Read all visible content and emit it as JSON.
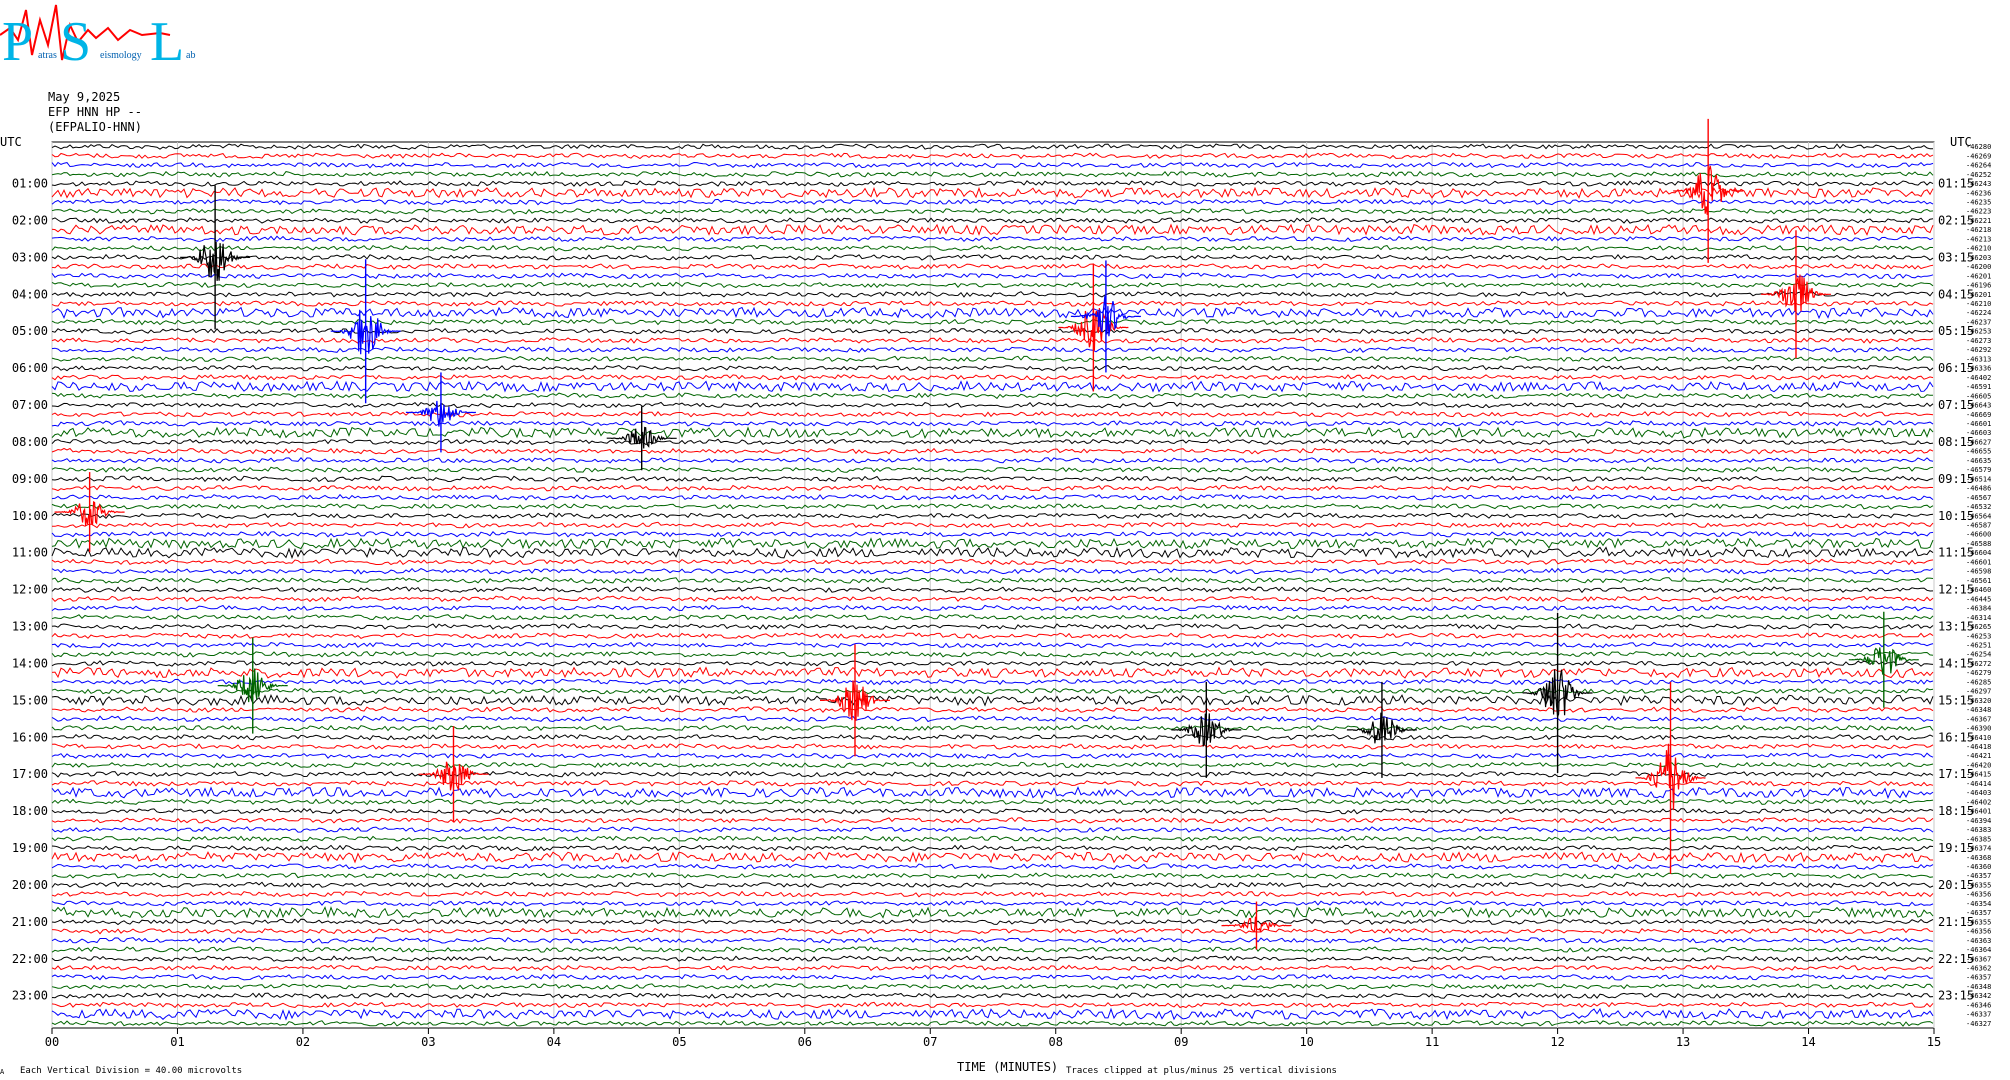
{
  "header": {
    "date": "May 9,2025",
    "station_line": "EFP HNN HP --",
    "channel_id": "(EFPALIO-HNN)"
  },
  "logo": {
    "letters": [
      "P",
      "S",
      "L"
    ],
    "words": [
      "atras",
      "eismology",
      "ab"
    ]
  },
  "chart_data": {
    "type": "line",
    "title": "",
    "xlabel": "TIME (MINUTES)",
    "x_ticks": [
      "00",
      "01",
      "02",
      "03",
      "04",
      "05",
      "06",
      "07",
      "08",
      "09",
      "10",
      "11",
      "12",
      "13",
      "14",
      "15"
    ],
    "xlim": [
      0,
      15
    ],
    "left_axis_title": "UTC",
    "right_axis_title": "UTC",
    "left_hour_labels": [
      "01:00",
      "02:00",
      "03:00",
      "04:00",
      "05:00",
      "06:00",
      "07:00",
      "08:00",
      "09:00",
      "10:00",
      "11:00",
      "12:00",
      "13:00",
      "14:00",
      "15:00",
      "16:00",
      "17:00",
      "18:00",
      "19:00",
      "20:00",
      "21:00",
      "22:00",
      "23:00"
    ],
    "right_hour_labels": [
      "01:15",
      "02:15",
      "03:15",
      "04:15",
      "05:15",
      "06:15",
      "07:15",
      "08:15",
      "09:15",
      "10:15",
      "11:15",
      "12:15",
      "13:15",
      "14:15",
      "15:15",
      "16:15",
      "17:15",
      "18:15",
      "19:15",
      "20:15",
      "21:15",
      "22:15",
      "23:15"
    ],
    "trace_count": 96,
    "trace_minutes": 15,
    "trace_colors": [
      "#000000",
      "#ff0000",
      "#0000ff",
      "#006400"
    ],
    "grid": true,
    "trace_offsets": [
      "-46280",
      "-46269",
      "-46264",
      "-46252",
      "-46243",
      "-46236",
      "-46235",
      "-46223",
      "-46221",
      "-46218",
      "-46213",
      "-46210",
      "-46203",
      "-46200",
      "-46201",
      "-46196",
      "-46201",
      "-46210",
      "-46224",
      "-46237",
      "-46253",
      "-46273",
      "-46292",
      "-46313",
      "-46336",
      "-46402",
      "-46591",
      "-46605",
      "-46643",
      "-46669",
      "-46601",
      "-46603",
      "-46627",
      "-46655",
      "-46635",
      "-46579",
      "-46514",
      "-46486",
      "-46567",
      "-46532",
      "-46564",
      "-46587",
      "-46600",
      "-46588",
      "-46604",
      "-46601",
      "-46598",
      "-46561",
      "-46460",
      "-46445",
      "-46384",
      "-46314",
      "-46265",
      "-46253",
      "-46251",
      "-46254",
      "-46272",
      "-46279",
      "-46285",
      "-46297",
      "-46320",
      "-46348",
      "-46367",
      "-46390",
      "-46410",
      "-46418",
      "-46421",
      "-46420",
      "-46415",
      "-46414",
      "-46403",
      "-46402",
      "-46401",
      "-46394",
      "-46383",
      "-46385",
      "-46374",
      "-46368",
      "-46360",
      "-46357",
      "-46355",
      "-46356",
      "-46354",
      "-46357",
      "-46355",
      "-46356",
      "-46363",
      "-46364",
      "-46367",
      "-46362",
      "-46357",
      "-46348",
      "-46342",
      "-46346",
      "-46337",
      "-46327"
    ],
    "events": [
      {
        "minute": 1.3,
        "hour": 3.0,
        "color": "#000000",
        "amp": 9
      },
      {
        "minute": 2.5,
        "hour": 5.0,
        "color": "#0000ff",
        "amp": 9
      },
      {
        "minute": 3.1,
        "hour": 7.2,
        "color": "#0000ff",
        "amp": 5
      },
      {
        "minute": 4.7,
        "hour": 7.9,
        "color": "#000000",
        "amp": 4
      },
      {
        "minute": 8.3,
        "hour": 4.9,
        "color": "#ff0000",
        "amp": 8
      },
      {
        "minute": 8.4,
        "hour": 4.6,
        "color": "#0000ff",
        "amp": 7
      },
      {
        "minute": 13.2,
        "hour": 1.2,
        "color": "#ff0000",
        "amp": 9
      },
      {
        "minute": 13.9,
        "hour": 4.0,
        "color": "#ff0000",
        "amp": 8
      },
      {
        "minute": 0.3,
        "hour": 9.9,
        "color": "#ff0000",
        "amp": 5
      },
      {
        "minute": 12.0,
        "hour": 14.8,
        "color": "#000000",
        "amp": 10
      },
      {
        "minute": 12.9,
        "hour": 17.1,
        "color": "#ff0000",
        "amp": 12
      },
      {
        "minute": 6.4,
        "hour": 15.0,
        "color": "#ff0000",
        "amp": 7
      },
      {
        "minute": 3.2,
        "hour": 17.0,
        "color": "#ff0000",
        "amp": 6
      },
      {
        "minute": 1.6,
        "hour": 14.6,
        "color": "#006400",
        "amp": 6
      },
      {
        "minute": 9.2,
        "hour": 15.8,
        "color": "#000000",
        "amp": 6
      },
      {
        "minute": 10.6,
        "hour": 15.8,
        "color": "#000000",
        "amp": 6
      },
      {
        "minute": 9.6,
        "hour": 21.1,
        "color": "#ff0000",
        "amp": 3
      },
      {
        "minute": 14.6,
        "hour": 13.9,
        "color": "#006400",
        "amp": 6
      }
    ]
  },
  "footer": {
    "scale_note": "Each Vertical Division = 40.00 microvolts",
    "clip_note": "Traces clipped at plus/minus 25 vertical divisions",
    "corner_mark": "A"
  }
}
